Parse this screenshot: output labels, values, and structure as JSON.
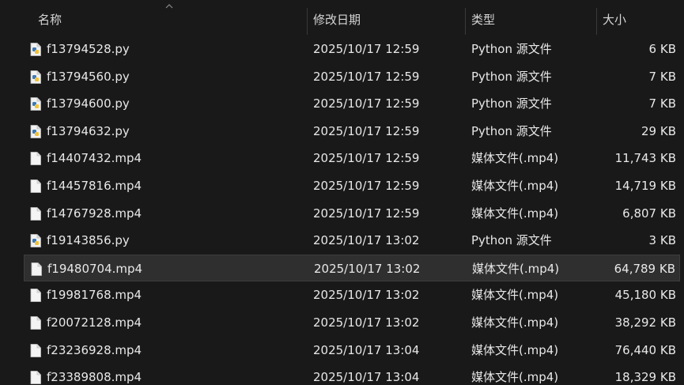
{
  "header": {
    "name_label": "名称",
    "date_label": "修改日期",
    "type_label": "类型",
    "size_label": "大小"
  },
  "files": [
    {
      "name": "f13794528.py",
      "date": "2025/10/17 12:59",
      "type": "Python 源文件",
      "size": "6 KB",
      "icon": "python-file-icon"
    },
    {
      "name": "f13794560.py",
      "date": "2025/10/17 12:59",
      "type": "Python 源文件",
      "size": "7 KB",
      "icon": "python-file-icon"
    },
    {
      "name": "f13794600.py",
      "date": "2025/10/17 12:59",
      "type": "Python 源文件",
      "size": "7 KB",
      "icon": "python-file-icon"
    },
    {
      "name": "f13794632.py",
      "date": "2025/10/17 12:59",
      "type": "Python 源文件",
      "size": "29 KB",
      "icon": "python-file-icon"
    },
    {
      "name": "f14407432.mp4",
      "date": "2025/10/17 12:59",
      "type": "媒体文件(.mp4)",
      "size": "11,743 KB",
      "icon": "media-file-icon"
    },
    {
      "name": "f14457816.mp4",
      "date": "2025/10/17 12:59",
      "type": "媒体文件(.mp4)",
      "size": "14,719 KB",
      "icon": "media-file-icon"
    },
    {
      "name": "f14767928.mp4",
      "date": "2025/10/17 12:59",
      "type": "媒体文件(.mp4)",
      "size": "6,807 KB",
      "icon": "media-file-icon"
    },
    {
      "name": "f19143856.py",
      "date": "2025/10/17 13:02",
      "type": "Python 源文件",
      "size": "3 KB",
      "icon": "python-file-icon"
    },
    {
      "name": "f19480704.mp4",
      "date": "2025/10/17 13:02",
      "type": "媒体文件(.mp4)",
      "size": "64,789 KB",
      "icon": "media-file-icon",
      "selected": true
    },
    {
      "name": "f19981768.mp4",
      "date": "2025/10/17 13:02",
      "type": "媒体文件(.mp4)",
      "size": "45,180 KB",
      "icon": "media-file-icon"
    },
    {
      "name": "f20072128.mp4",
      "date": "2025/10/17 13:02",
      "type": "媒体文件(.mp4)",
      "size": "38,292 KB",
      "icon": "media-file-icon"
    },
    {
      "name": "f23236928.mp4",
      "date": "2025/10/17 13:04",
      "type": "媒体文件(.mp4)",
      "size": "76,440 KB",
      "icon": "media-file-icon"
    },
    {
      "name": "f23389808.mp4",
      "date": "2025/10/17 13:04",
      "type": "媒体文件(.mp4)",
      "size": "18,329 KB",
      "icon": "media-file-icon"
    }
  ]
}
